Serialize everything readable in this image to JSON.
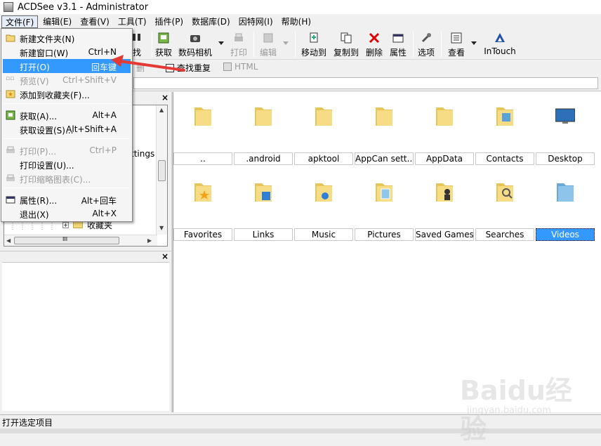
{
  "window": {
    "title": "ACDSee v3.1 - Administrator"
  },
  "menubar": [
    {
      "label": "文件(F)",
      "active": true
    },
    {
      "label": "编辑(E)"
    },
    {
      "label": "查看(V)"
    },
    {
      "label": "工具(T)"
    },
    {
      "label": "插件(P)"
    },
    {
      "label": "数据库(D)"
    },
    {
      "label": "因特网(I)"
    },
    {
      "label": "帮助(H)"
    }
  ],
  "toolbar": {
    "partial_label": "找",
    "acquire": "获取",
    "camera": "数码相机",
    "print": "打印",
    "edit": "编辑",
    "move_to": "移动到",
    "copy_to": "复制到",
    "delete": "删除",
    "properties": "属性",
    "options": "选项",
    "view": "查看",
    "intouch": "InTouch"
  },
  "toolbar2": {
    "partial": "删",
    "find_duplicates": "查找重复",
    "html": "HTML"
  },
  "tree": {
    "partial_item": "ttings",
    "favorites_item": "收藏夹",
    "hscroll_grip": "III"
  },
  "file_menu": {
    "items": [
      {
        "label": "新建文件夹(N)",
        "shortcut": ""
      },
      {
        "label": "新建窗口(W)",
        "shortcut": "Ctrl+N"
      },
      {
        "label": "打开(O)",
        "shortcut": "回车键",
        "highlighted": true
      },
      {
        "label": "预览(V)",
        "shortcut": "Ctrl+Shift+V",
        "disabled": true
      },
      {
        "label": "添加到收藏夹(F)...",
        "shortcut": ""
      },
      {
        "label": "获取(A)...",
        "shortcut": "Alt+A"
      },
      {
        "label": "获取设置(S)...",
        "shortcut": "Alt+Shift+A"
      },
      {
        "label": "打印(P)...",
        "shortcut": "Ctrl+P",
        "disabled": true
      },
      {
        "label": "打印设置(U)...",
        "shortcut": ""
      },
      {
        "label": "打印缩略图表(C)...",
        "shortcut": "",
        "disabled": true
      },
      {
        "label": "属性(R)...",
        "shortcut": "Alt+回车"
      },
      {
        "label": "退出(X)",
        "shortcut": "Alt+X"
      }
    ]
  },
  "files": [
    {
      "name": "..",
      "icon": "folder-icon"
    },
    {
      "name": ".android",
      "icon": "folder-icon"
    },
    {
      "name": "apktool",
      "icon": "folder-icon"
    },
    {
      "name": "AppCan sett...",
      "icon": "folder-icon"
    },
    {
      "name": "AppData",
      "icon": "folder-icon"
    },
    {
      "name": "Contacts",
      "icon": "contacts-folder-icon"
    },
    {
      "name": "Desktop",
      "icon": "desktop-icon"
    },
    {
      "name": "Favorites",
      "icon": "favorites-folder-icon"
    },
    {
      "name": "Links",
      "icon": "links-folder-icon"
    },
    {
      "name": "Music",
      "icon": "music-folder-icon"
    },
    {
      "name": "Pictures",
      "icon": "pictures-folder-icon"
    },
    {
      "name": "Saved Games",
      "icon": "saved-games-folder-icon"
    },
    {
      "name": "Searches",
      "icon": "searches-folder-icon"
    },
    {
      "name": "Videos",
      "icon": "videos-folder-icon",
      "selected": true
    }
  ],
  "statusbar": {
    "text": "打开选定项目"
  },
  "watermark": {
    "line1": "Baidu经验",
    "line2": "jingyan.baidu.com"
  },
  "colors": {
    "highlight": "#3399ff",
    "annotation_arrow": "#e53935",
    "folder": "#f3d77a"
  }
}
